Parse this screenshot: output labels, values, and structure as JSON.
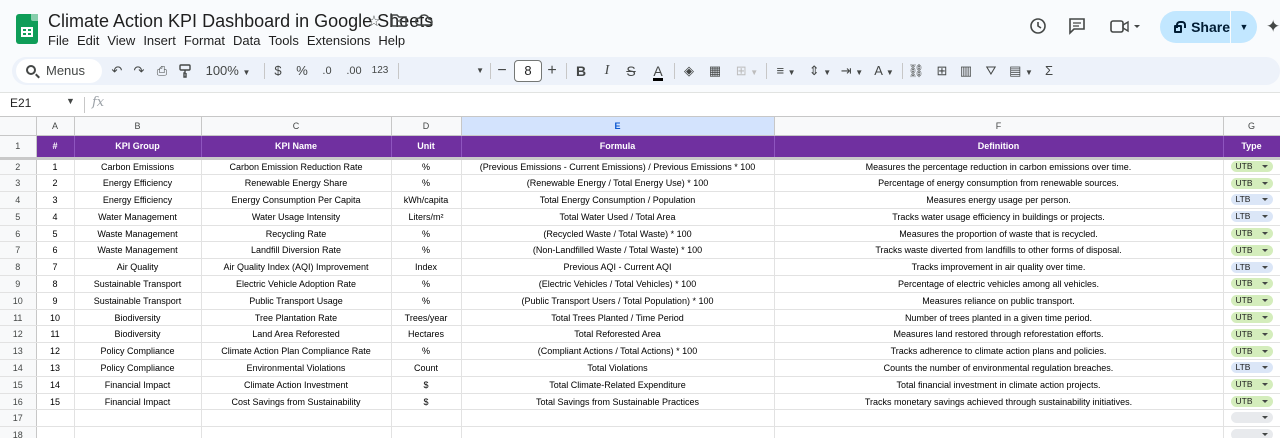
{
  "app": {
    "title": "Climate Action KPI Dashboard in Google Sheets",
    "menu": [
      "File",
      "Edit",
      "View",
      "Insert",
      "Format",
      "Data",
      "Tools",
      "Extensions",
      "Help"
    ],
    "share_label": "Share"
  },
  "toolbar": {
    "search_label": "Menus",
    "zoom": "100%",
    "currency": "$",
    "percent": "%",
    "decrease_decimal": ".0",
    "increase_decimal": ".00",
    "number_format": "123",
    "font_size": "8"
  },
  "formula_bar": {
    "cell_ref": "E21",
    "fx": "fx",
    "value": ""
  },
  "columns": [
    "A",
    "B",
    "C",
    "D",
    "E",
    "F",
    "G"
  ],
  "headers": [
    "#",
    "KPI Group",
    "KPI Name",
    "Unit",
    "Formula",
    "Definition",
    "Type"
  ],
  "rows": [
    {
      "n": "1",
      "group": "Carbon Emissions",
      "name": "Carbon Emission Reduction Rate",
      "unit": "%",
      "formula": "(Previous Emissions - Current Emissions) / Previous Emissions * 100",
      "def": "Measures the percentage reduction in carbon emissions over time.",
      "type": "UTB"
    },
    {
      "n": "2",
      "group": "Energy Efficiency",
      "name": "Renewable Energy Share",
      "unit": "%",
      "formula": "(Renewable Energy / Total Energy Use) * 100",
      "def": "Percentage of energy consumption from renewable sources.",
      "type": "UTB"
    },
    {
      "n": "3",
      "group": "Energy Efficiency",
      "name": "Energy Consumption Per Capita",
      "unit": "kWh/capita",
      "formula": "Total Energy Consumption / Population",
      "def": "Measures energy usage per person.",
      "type": "LTB"
    },
    {
      "n": "4",
      "group": "Water Management",
      "name": "Water Usage Intensity",
      "unit": "Liters/m²",
      "formula": "Total Water Used / Total Area",
      "def": "Tracks water usage efficiency in buildings or projects.",
      "type": "LTB"
    },
    {
      "n": "5",
      "group": "Waste Management",
      "name": "Recycling Rate",
      "unit": "%",
      "formula": "(Recycled Waste / Total Waste) * 100",
      "def": "Measures the proportion of waste that is recycled.",
      "type": "UTB"
    },
    {
      "n": "6",
      "group": "Waste Management",
      "name": "Landfill Diversion Rate",
      "unit": "%",
      "formula": "(Non-Landfilled Waste / Total Waste) * 100",
      "def": "Tracks waste diverted from landfills to other forms of disposal.",
      "type": "UTB"
    },
    {
      "n": "7",
      "group": "Air Quality",
      "name": "Air Quality Index (AQI) Improvement",
      "unit": "Index",
      "formula": "Previous AQI - Current AQI",
      "def": "Tracks improvement in air quality over time.",
      "type": "LTB"
    },
    {
      "n": "8",
      "group": "Sustainable Transport",
      "name": "Electric Vehicle Adoption Rate",
      "unit": "%",
      "formula": "(Electric Vehicles / Total Vehicles) * 100",
      "def": "Percentage of electric vehicles among all vehicles.",
      "type": "UTB"
    },
    {
      "n": "9",
      "group": "Sustainable Transport",
      "name": "Public Transport Usage",
      "unit": "%",
      "formula": "(Public Transport Users / Total Population) * 100",
      "def": "Measures reliance on public transport.",
      "type": "UTB"
    },
    {
      "n": "10",
      "group": "Biodiversity",
      "name": "Tree Plantation Rate",
      "unit": "Trees/year",
      "formula": "Total Trees Planted / Time Period",
      "def": "Number of trees planted in a given time period.",
      "type": "UTB"
    },
    {
      "n": "11",
      "group": "Biodiversity",
      "name": "Land Area Reforested",
      "unit": "Hectares",
      "formula": "Total Reforested Area",
      "def": "Measures land restored through reforestation efforts.",
      "type": "UTB"
    },
    {
      "n": "12",
      "group": "Policy Compliance",
      "name": "Climate Action Plan Compliance Rate",
      "unit": "%",
      "formula": "(Compliant Actions / Total Actions) * 100",
      "def": "Tracks adherence to climate action plans and policies.",
      "type": "UTB"
    },
    {
      "n": "13",
      "group": "Policy Compliance",
      "name": "Environmental Violations",
      "unit": "Count",
      "formula": "Total Violations",
      "def": "Counts the number of environmental regulation breaches.",
      "type": "LTB"
    },
    {
      "n": "14",
      "group": "Financial Impact",
      "name": "Climate Action Investment",
      "unit": "$",
      "formula": "Total Climate-Related Expenditure",
      "def": "Total financial investment in climate action projects.",
      "type": "UTB"
    },
    {
      "n": "15",
      "group": "Financial Impact",
      "name": "Cost Savings from Sustainability",
      "unit": "$",
      "formula": "Total Savings from Sustainable Practices",
      "def": "Tracks monetary savings achieved through sustainability initiatives.",
      "type": "UTB"
    }
  ],
  "row_numbers": [
    "1",
    "2",
    "3",
    "4",
    "5",
    "6",
    "7",
    "8",
    "9",
    "10",
    "11",
    "12",
    "13",
    "14",
    "15",
    "16",
    "17",
    "18"
  ],
  "colors": {
    "header_bg": "#7030a0",
    "utb": "#d4edbc",
    "ltb": "#dbe6f7",
    "share": "#c2e7ff"
  }
}
